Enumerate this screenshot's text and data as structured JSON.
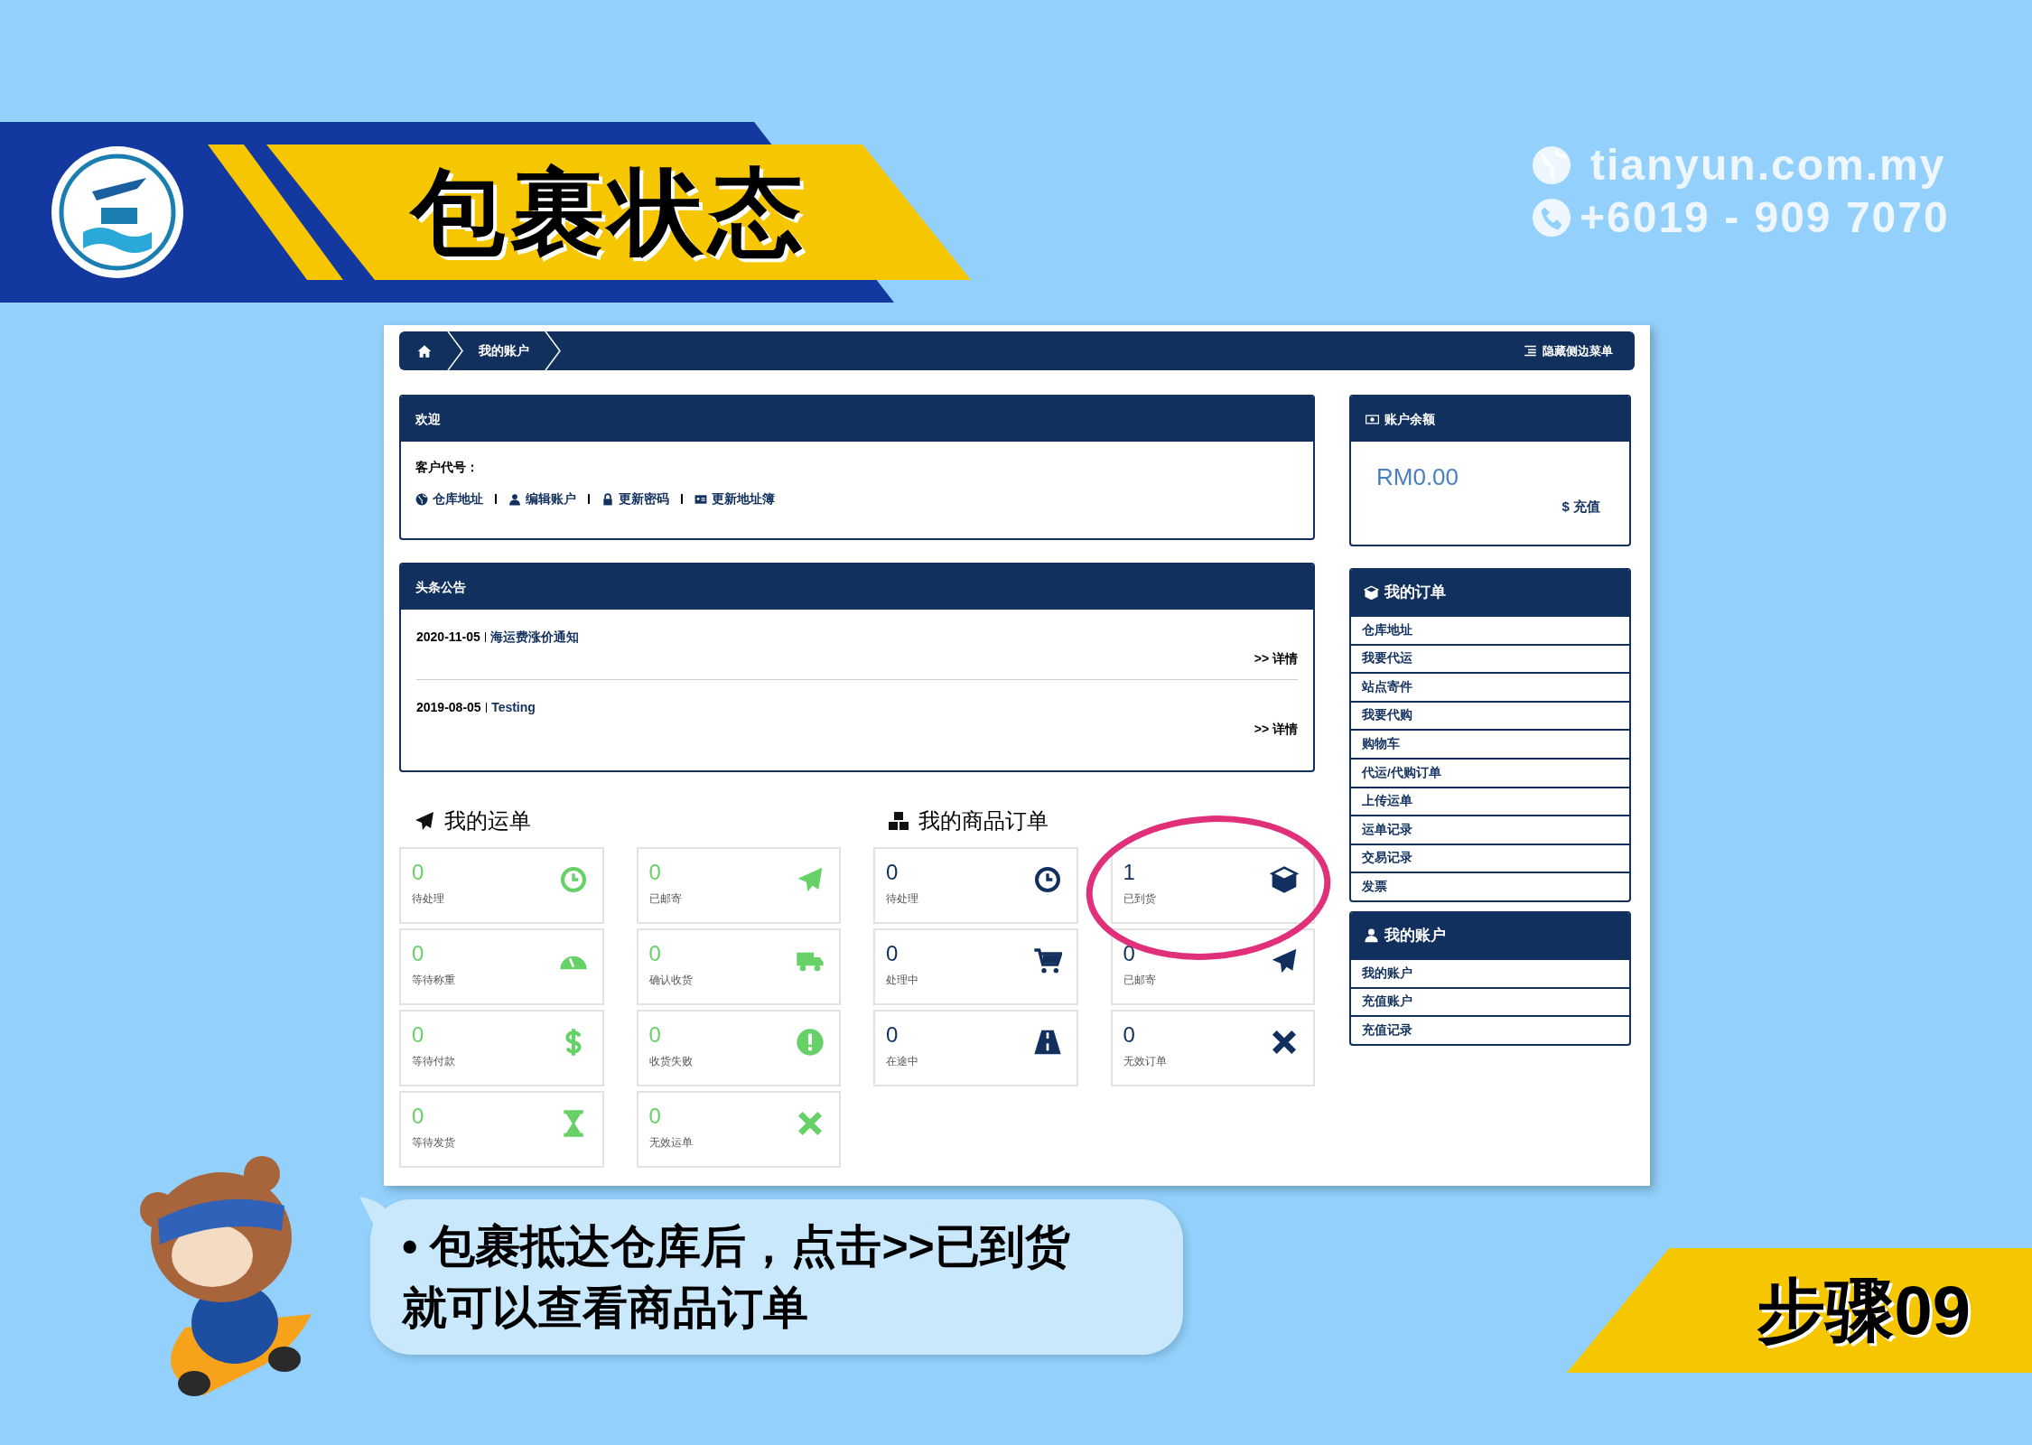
{
  "banner": {
    "title": "包裹状态",
    "website": "tianyun.com.my",
    "phone": "+6019 - 909 7070"
  },
  "screen": {
    "breadcrumb": [
      "我的账户"
    ],
    "toggle_menu": "隐藏侧边菜单",
    "welcome": {
      "title": "欢迎",
      "customer_code_label": "客户代号：",
      "links": [
        {
          "label": "仓库地址",
          "kind": "globe"
        },
        {
          "label": "编辑账户",
          "kind": "user"
        },
        {
          "label": "更新密码",
          "kind": "lock"
        },
        {
          "label": "更新地址簿",
          "kind": "card"
        }
      ]
    },
    "announcements": {
      "title": "头条公告",
      "items": [
        {
          "date": "2020-11-05",
          "title": "海运费涨价通知",
          "more": ">> 详情"
        },
        {
          "date": "2019-08-05",
          "title": "Testing",
          "more": ">> 详情"
        }
      ]
    },
    "sections": [
      {
        "title": "我的运单",
        "kind": "plane",
        "color": "#66d166",
        "columns": [
          [
            {
              "count": "0",
              "label": "待处理",
              "kind": "clock",
              "circled": false
            },
            {
              "count": "0",
              "label": "等待称重",
              "kind": "gauge",
              "circled": false
            },
            {
              "count": "0",
              "label": "等待付款",
              "kind": "dollar",
              "circled": false
            },
            {
              "count": "0",
              "label": "等待发货",
              "kind": "hourglass",
              "circled": false
            }
          ],
          [
            {
              "count": "0",
              "label": "已邮寄",
              "kind": "plane",
              "circled": false
            },
            {
              "count": "0",
              "label": "确认收货",
              "kind": "truck",
              "circled": false
            },
            {
              "count": "0",
              "label": "收货失败",
              "kind": "alert",
              "circled": false
            },
            {
              "count": "0",
              "label": "无效运单",
              "kind": "x",
              "circled": false
            }
          ]
        ]
      },
      {
        "title": "我的商品订单",
        "kind": "cubes",
        "color": "#11305e",
        "columns": [
          [
            {
              "count": "0",
              "label": "待处理",
              "kind": "clock",
              "circled": false
            },
            {
              "count": "0",
              "label": "处理中",
              "kind": "cart",
              "circled": false
            },
            {
              "count": "0",
              "label": "在途中",
              "kind": "road",
              "circled": false
            }
          ],
          [
            {
              "count": "1",
              "label": "已到货",
              "kind": "box",
              "circled": true
            },
            {
              "count": "0",
              "label": "已邮寄",
              "kind": "plane",
              "circled": false
            },
            {
              "count": "0",
              "label": "无效订单",
              "kind": "x",
              "circled": false
            }
          ]
        ]
      }
    ],
    "balance": {
      "title": "账户余额",
      "amount": "RM0.00",
      "topup": "$ 充值"
    },
    "menus": [
      {
        "title": "我的订单",
        "kind": "box",
        "items": [
          "仓库地址",
          "我要代运",
          "站点寄件",
          "我要代购",
          "购物车",
          "代运/代购订单",
          "上传运单",
          "运单记录",
          "交易记录",
          "发票"
        ]
      },
      {
        "title": "我的账户",
        "kind": "user",
        "items": [
          "我的账户",
          "充值账户",
          "充值记录"
        ]
      }
    ]
  },
  "callout": {
    "lines": [
      "• 包裹抵达仓库后，点击>>已到货",
      "就可以查看商品订单"
    ]
  },
  "step": "步骤09"
}
